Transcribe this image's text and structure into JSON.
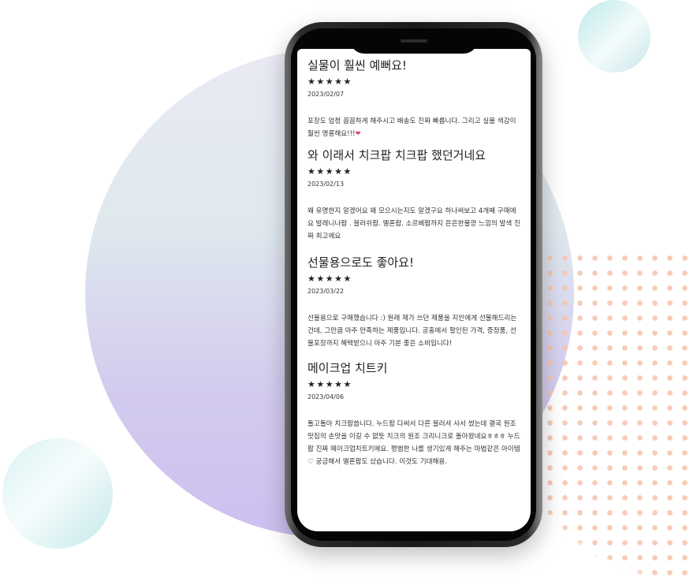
{
  "reviews": [
    {
      "title": "실물이 훨씬 예뻐요!",
      "stars": "★★★★★",
      "date": "2023/02/07",
      "body": "포장도 엄청 꼼꼼하게 해주시고 배송도 진짜 빠릅니다. 그리고 실물 색감이 훨씬 영롱해요!!!",
      "emoji": "❤"
    },
    {
      "title": "와 이래서 치크팝 치크팝 했던거네요",
      "stars": "★★★★★",
      "date": "2023/02/13",
      "body": "왜 유명한지 알겠어요 왜 모으시는지도 알겠구요 하나써보고 4개째 구매에요 발레니나팝 . 블러쉬팝. 멜론팝. 소르베팝까지 은은한물광 느낌의 발색 진짜 최고에요"
    },
    {
      "title": "선물용으로도 좋아요!",
      "stars": "★★★★★",
      "date": "2023/03/22",
      "body": "선물용으로 구매했습니다 :) 원래 제가 쓰던 제품을 지인에게 선물해드리는건데, 그만큼 아주 만족하는 제품입니다. 공홈에서 할인된 가격, 증정품, 선물포장까지 혜택받으니 아주 기분 좋은 소비입니다!"
    },
    {
      "title": "메이크업 치트키",
      "stars": "★★★★★",
      "date": "2023/04/06",
      "body": "돌고돌아 치크팝씁니다. 누드팝 다써서 다른 블러셔 사서 썼는데 결국 원조맛집의 손맛을 이길 수 없듯 치크의 원조 크리니크로 돌아왔네요ㅎㅎㅎ 누드팝 진짜 메이크업치트키에요. 평범한 나를 생기있게 해주는 마법같은 아이템♡ 궁금해서 멜론팝도 샀습니다. 이것도 기대해용."
    }
  ]
}
